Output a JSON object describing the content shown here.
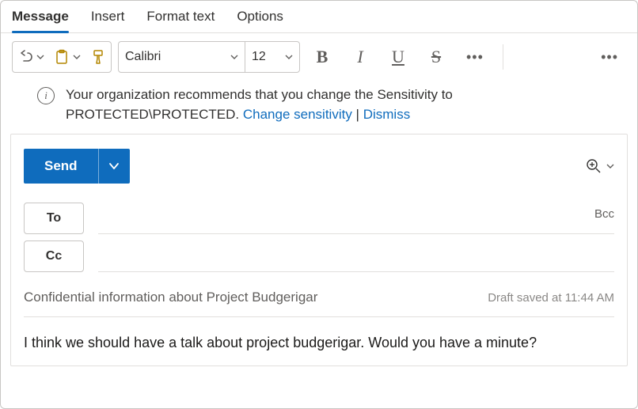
{
  "tabs": {
    "message": "Message",
    "insert": "Insert",
    "format_text": "Format text",
    "options": "Options"
  },
  "toolbar": {
    "font_name": "Calibri",
    "font_size": "12",
    "bold": "B",
    "italic": "I",
    "underline": "U",
    "strike": "S"
  },
  "infobar": {
    "line1": "Your organization recommends that you change the Sensitivity to",
    "line2_prefix": "PROTECTED\\PROTECTED. ",
    "change_link": "Change sensitivity",
    "separator": " | ",
    "dismiss_link": "Dismiss"
  },
  "compose": {
    "send_label": "Send",
    "to_label": "To",
    "cc_label": "Cc",
    "bcc_label": "Bcc",
    "subject": "Confidential information about Project Budgerigar",
    "draft_status": "Draft saved at 11:44 AM",
    "body": "I think we should have a talk about project budgerigar. Would you have a minute?"
  }
}
